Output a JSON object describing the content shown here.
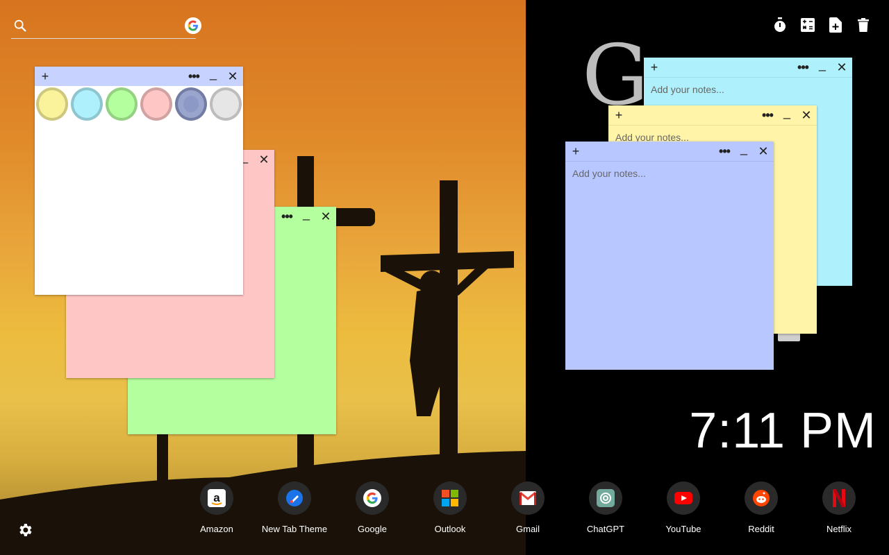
{
  "search": {
    "placeholder": "",
    "engine_icon": "google-icon"
  },
  "toolbar": {
    "buttons": [
      {
        "icon": "stopwatch-icon"
      },
      {
        "icon": "calculator-icon"
      },
      {
        "icon": "new-note-icon"
      },
      {
        "icon": "trash-icon"
      }
    ]
  },
  "notes": {
    "placeholder": "Add your notes...",
    "add_label": "+",
    "menu_label": "•••",
    "minimize_label": "_",
    "close_label": "✕",
    "colors": {
      "white": "#ffffff",
      "pink": "#ffc6c6",
      "green": "#b4ff9e",
      "cyan": "#aef0fb",
      "yellow": "#fff4a8",
      "blue": "#b8c7ff"
    },
    "palette": [
      "#fbf39b",
      "#aef0fb",
      "#b4ff9e",
      "#ffc6c6",
      "#8c99c7",
      "#e6e6e6"
    ]
  },
  "clock": {
    "time": "7:11 PM"
  },
  "shortcuts": [
    {
      "label": "Amazon",
      "icon": "amazon-icon"
    },
    {
      "label": "New Tab Theme",
      "icon": "new-tab-theme-icon"
    },
    {
      "label": "Google",
      "icon": "google-icon"
    },
    {
      "label": "Outlook",
      "icon": "outlook-icon"
    },
    {
      "label": "Gmail",
      "icon": "gmail-icon"
    },
    {
      "label": "ChatGPT",
      "icon": "chatgpt-icon"
    },
    {
      "label": "YouTube",
      "icon": "youtube-icon"
    },
    {
      "label": "Reddit",
      "icon": "reddit-icon"
    },
    {
      "label": "Netflix",
      "icon": "netflix-icon"
    }
  ],
  "settings": {
    "icon": "gear-icon"
  }
}
